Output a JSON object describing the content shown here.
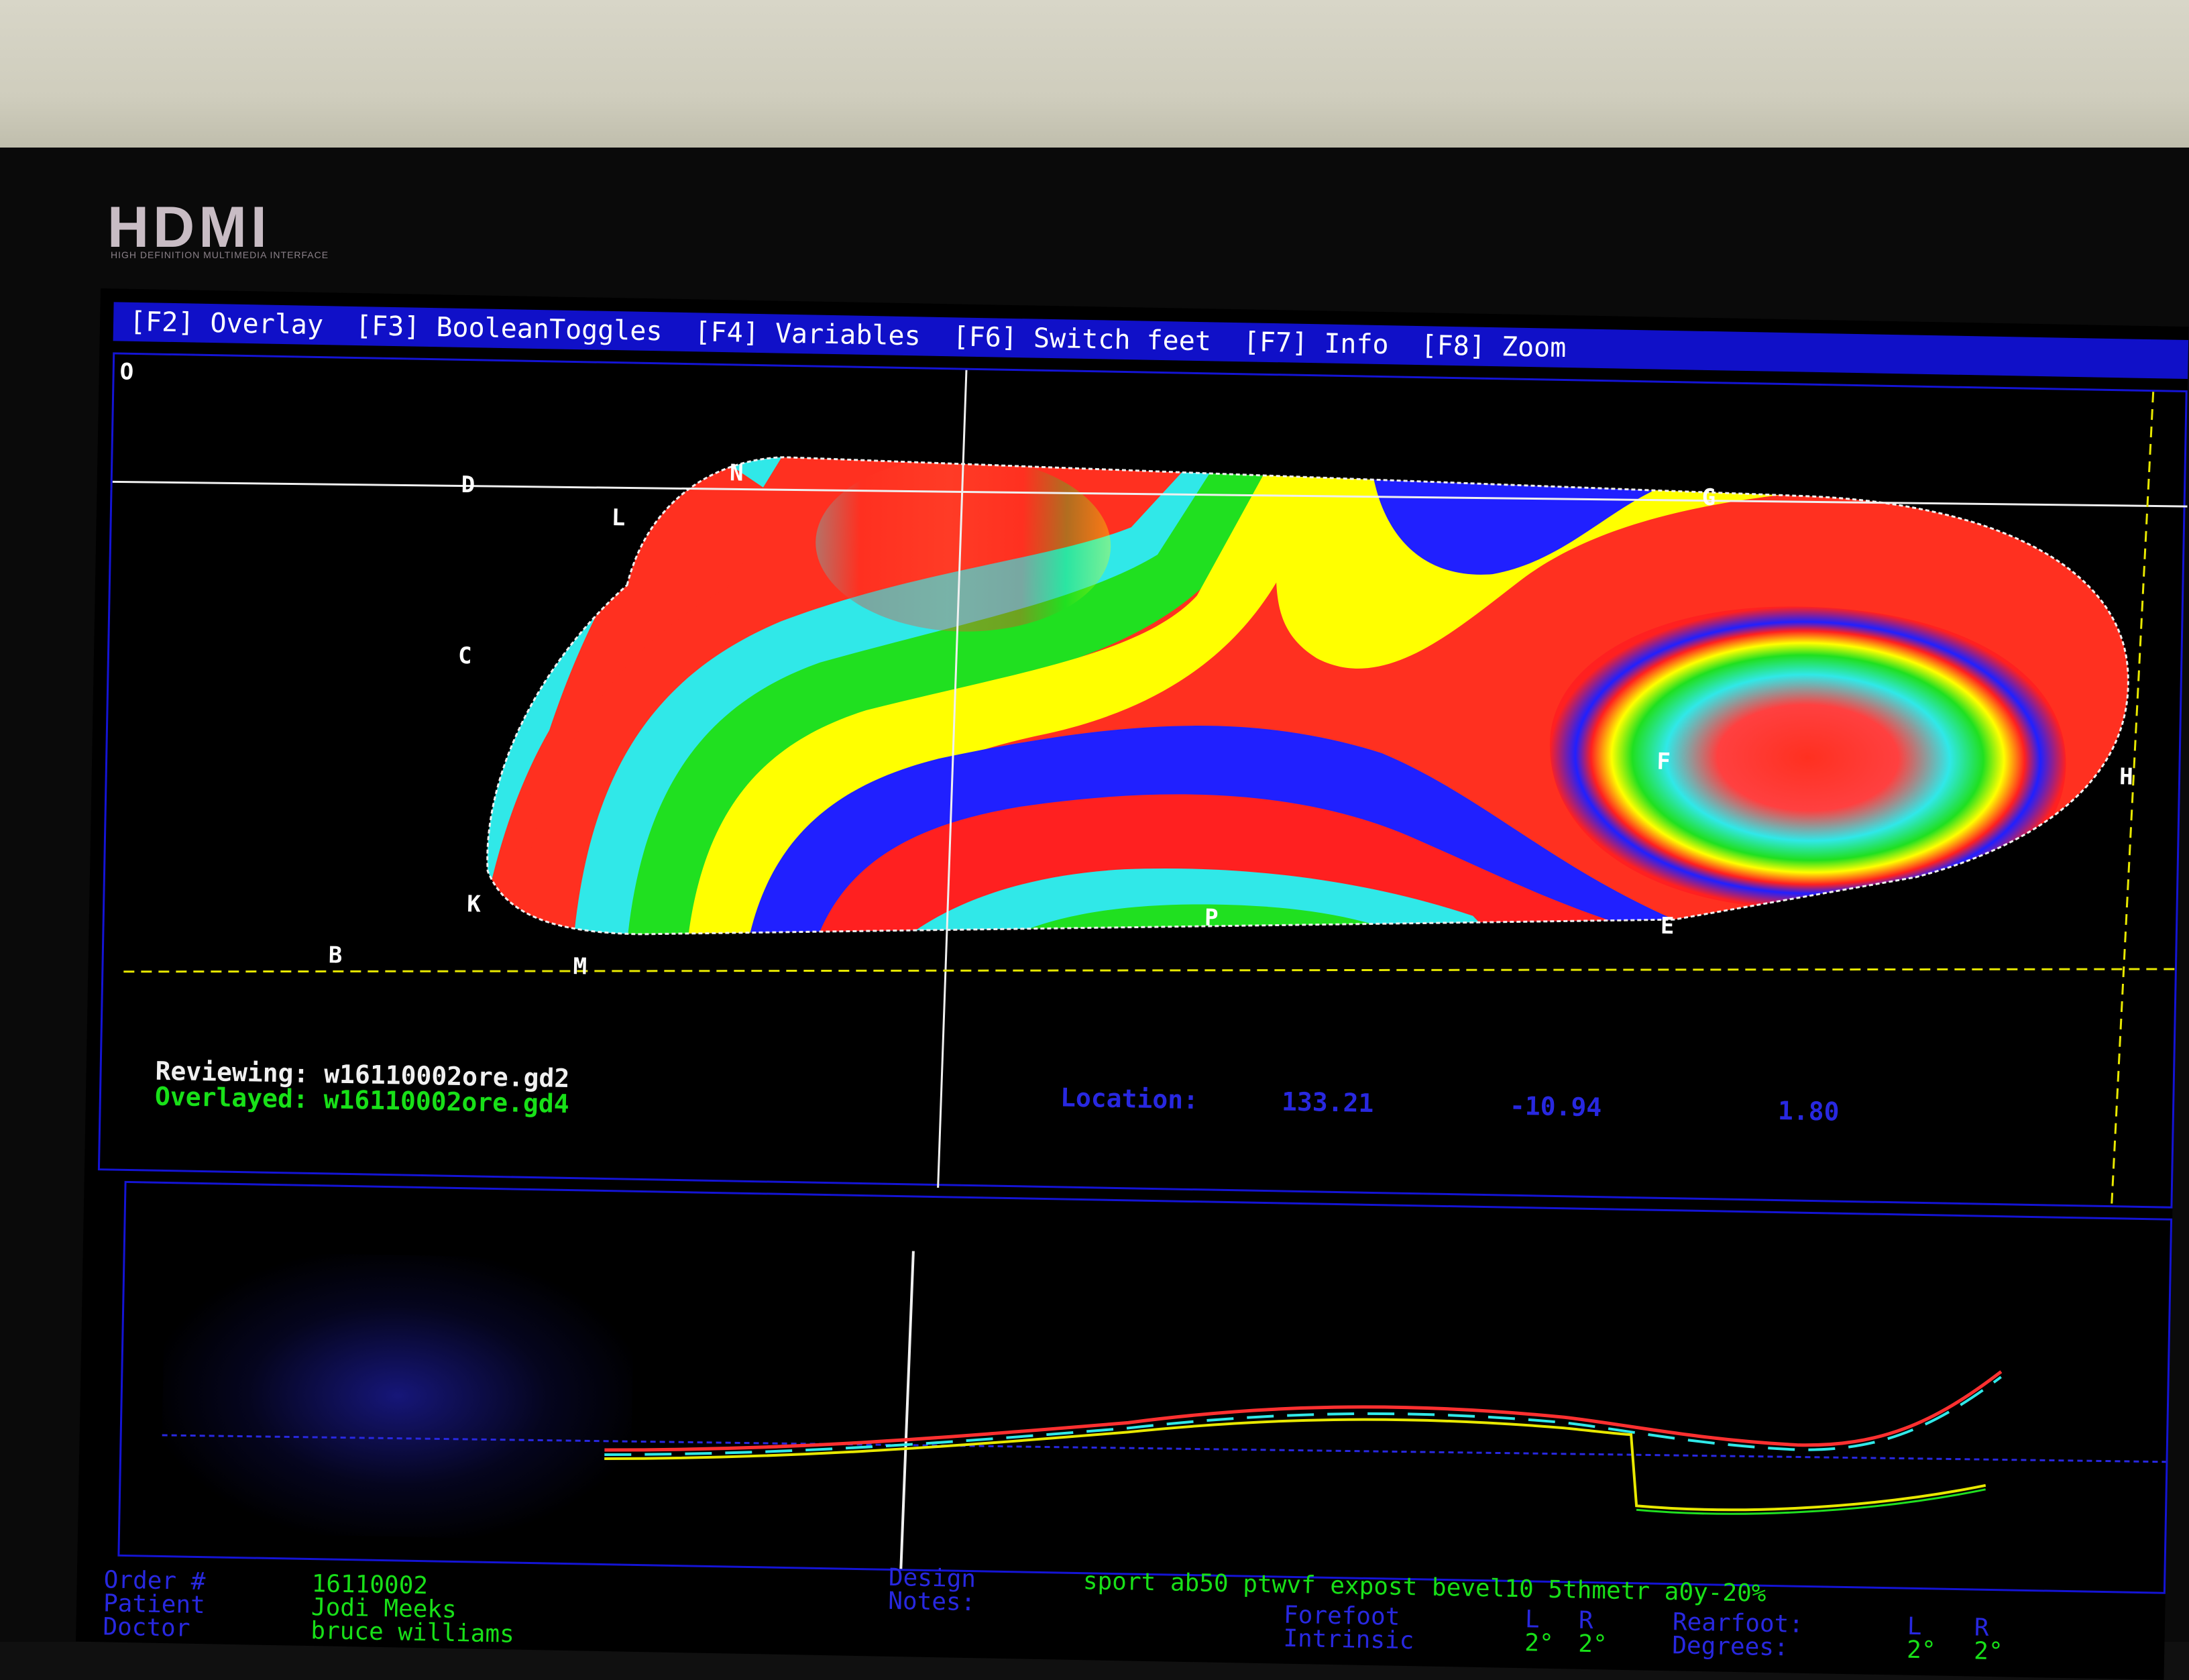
{
  "brand": {
    "name": "HDMI",
    "tagline": "HIGH DEFINITION MULTIMEDIA INTERFACE"
  },
  "menu": [
    {
      "key": "[F2]",
      "label": "Overlay"
    },
    {
      "key": "[F3]",
      "label": "BooleanToggles"
    },
    {
      "key": "[F4]",
      "label": "Variables"
    },
    {
      "key": "[F6]",
      "label": "Switch feet"
    },
    {
      "key": "[F7]",
      "label": "Info"
    },
    {
      "key": "[F8]",
      "label": "Zoom"
    }
  ],
  "viewer": {
    "origin_label": "O",
    "points": [
      "D",
      "N",
      "L",
      "G",
      "C",
      "F",
      "H",
      "K",
      "P",
      "E",
      "B",
      "M"
    ]
  },
  "status": {
    "reviewing_label": "Reviewing:",
    "reviewing_file": "w16110002ore.gd2",
    "overlayed_label": "Overlayed:",
    "overlayed_file": "w16110002ore.gd4",
    "location_label": "Location:",
    "location_x": "133.21",
    "location_y": "-10.94",
    "location_z": "1.80"
  },
  "order": {
    "order_label": "Order #",
    "order_value": "16110002",
    "patient_label": "Patient",
    "patient_value": "Jodi Meeks",
    "doctor_label": "Doctor",
    "doctor_value": "bruce williams"
  },
  "design": {
    "design_label": "Design",
    "notes_label": "Notes:",
    "design_value": "sport ab50 ptwvf expost bevel10 5thmetr a0y-20%"
  },
  "posting": {
    "forefoot_label": "Forefoot",
    "intrinsic_label": "Intrinsic",
    "l_label": "L",
    "r_label": "R",
    "forefoot_l": "2°",
    "forefoot_r": "2°",
    "rearfoot_label": "Rearfoot:",
    "degrees_label": "Degrees:",
    "rearfoot_l_label": "L",
    "rearfoot_r_label": "R",
    "rearfoot_l": "2°",
    "rearfoot_r": "2°"
  },
  "colors": {
    "menu_bg": "#1010c8",
    "frame": "#1414d4",
    "text_blue": "#2828e0",
    "text_green": "#18e018",
    "guide_yellow": "#e8e800"
  }
}
